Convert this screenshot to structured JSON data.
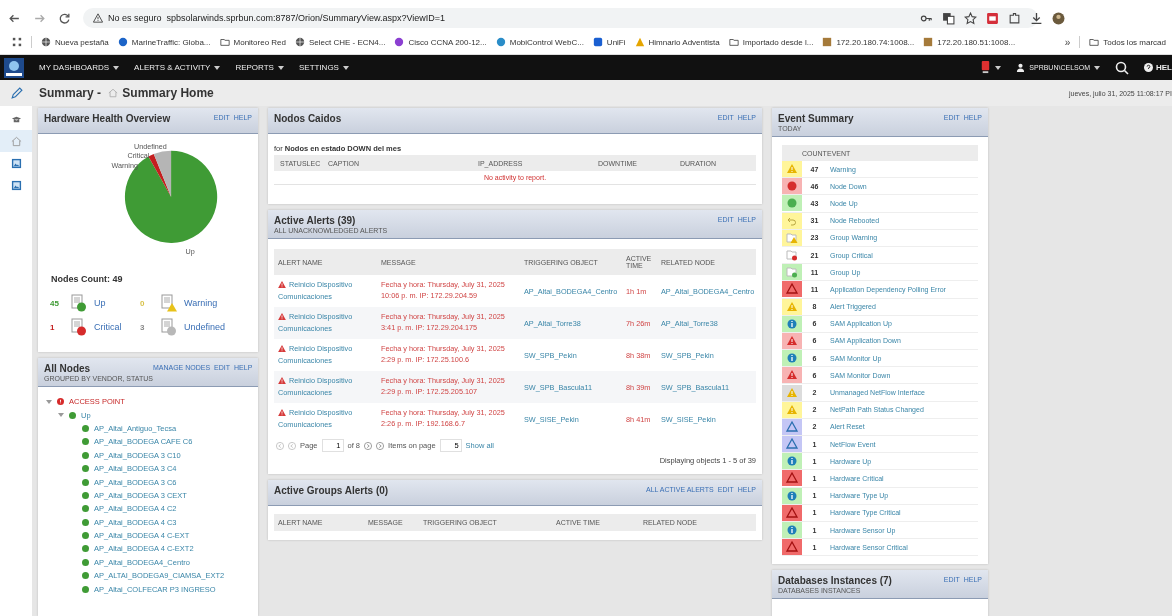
{
  "browser": {
    "security": "No es seguro",
    "url": "spbsolarwinds.sprbun.com:8787/Orion/SummaryView.aspx?ViewID=1",
    "bookmarks": [
      "Nueva pestaña",
      "MarineTraffic: Globa...",
      "Monitoreo Red",
      "Select CHE - ECN4...",
      "Cisco CCNA 200-12...",
      "MobiControl WebC...",
      "UniFi",
      "Himnario Adventista",
      "Importado desde l...",
      "172.20.180.74:1008...",
      "172.20.180.51:1008..."
    ],
    "more": "»",
    "all_bookmarks": "Todos los marcad"
  },
  "nav": {
    "menus": [
      "MY DASHBOARDS",
      "ALERTS & ACTIVITY",
      "REPORTS",
      "SETTINGS"
    ],
    "user": "SPRBUN\\CELSOM",
    "help": "HEL"
  },
  "title": {
    "prefix": "Summary - ",
    "view": "Summary Home",
    "datetime": "jueves, julio 31, 2025 11:08:17 PI"
  },
  "rail": [
    {
      "kind": "hat",
      "selected": false
    },
    {
      "kind": "home",
      "selected": true
    },
    {
      "kind": "image",
      "selected": false
    },
    {
      "kind": "image",
      "selected": false
    }
  ],
  "hardware": {
    "title": "Hardware Health Overview",
    "links": [
      "EDIT",
      "HELP"
    ],
    "chart_data": {
      "type": "pie",
      "categories": [
        "Up",
        "Warning",
        "Critical",
        "Undefined"
      ],
      "values": [
        91.84,
        0,
        2.04,
        6.12
      ]
    },
    "count_label": "Nodes Count: 49",
    "legend": [
      {
        "count": "45",
        "label": "Up",
        "kind": "up"
      },
      {
        "count": "0",
        "label": "Warning",
        "kind": "warning"
      },
      {
        "count": "1",
        "label": "Critical",
        "kind": "critical"
      },
      {
        "count": "3",
        "label": "Undefined",
        "kind": "undefined"
      }
    ]
  },
  "all_nodes": {
    "title": "All Nodes",
    "subtitle": "GROUPED BY VENDOR, STATUS",
    "links": [
      "MANAGE NODES",
      "EDIT",
      "HELP"
    ],
    "tree": [
      {
        "label": "ACCESS POINT",
        "kind": "critical",
        "expanded": true,
        "children": [
          {
            "label": "Up",
            "kind": "up",
            "expanded": true,
            "children": [
              {
                "label": "AP_Altai_Antiguo_Tecsa",
                "kind": "up"
              },
              {
                "label": "AP_Altai_BODEGA CAFE C6",
                "kind": "up"
              },
              {
                "label": "AP_Altai_BODEGA 3 C10",
                "kind": "up"
              },
              {
                "label": "AP_Altai_BODEGA 3 C4",
                "kind": "up"
              },
              {
                "label": "AP_Altai_BODEGA 3 C6",
                "kind": "up"
              },
              {
                "label": "AP_Altai_BODEGA 3 CEXT",
                "kind": "up"
              },
              {
                "label": "AP_Altai_BODEGA 4 C2",
                "kind": "up"
              },
              {
                "label": "AP_Altai_BODEGA 4 C3",
                "kind": "up"
              },
              {
                "label": "AP_Altai_BODEGA 4 C-EXT",
                "kind": "up"
              },
              {
                "label": "AP_Altai_BODEGA 4 C-EXT2",
                "kind": "up"
              },
              {
                "label": "AP_Altai_BODEGA4_Centro",
                "kind": "up"
              },
              {
                "label": "AP_ALTAI_BODEGA9_CIAMSA_EXT2",
                "kind": "up"
              },
              {
                "label": "AP_Altai_COLFECAR P3 INGRESO",
                "kind": "up"
              }
            ]
          }
        ]
      }
    ]
  },
  "nodos_caidos": {
    "title": "Nodos Caidos",
    "links": [
      "EDIT",
      "HELP"
    ],
    "intro": "for **Nodos en estado DOWN del mes**",
    "columns": [
      "STATUSLEC",
      "CAPTION",
      "IP_ADDRESS",
      "DOWNTIME",
      "DURATION"
    ],
    "empty": "No activity to report."
  },
  "active_alerts": {
    "title": "Active Alerts (39)",
    "subtitle": "ALL UNACKNOWLEDGED ALERTS",
    "links": [
      "EDIT",
      "HELP"
    ],
    "columns": [
      "ALERT NAME",
      "MESSAGE",
      "TRIGGERING OBJECT",
      "ACTIVE TIME",
      "RELATED NODE"
    ],
    "rows": [
      {
        "name": "Reinicio Dispositivo Comunicaciones",
        "message": "Fecha y hora: Thursday, July 31, 2025 10:06 p. m. IP: 172.29.204.59",
        "object": "AP_Altai_BODEGA4_Centro",
        "time": "1h 1m",
        "node": "AP_Altai_BODEGA4_Centro"
      },
      {
        "name": "Reinicio Dispositivo Comunicaciones",
        "message": "Fecha y hora: Thursday, July 31, 2025 3:41 p. m. IP: 172.29.204.175",
        "object": "AP_Altai_Torre38",
        "time": "7h 26m",
        "node": "AP_Altai_Torre38"
      },
      {
        "name": "Reinicio Dispositivo Comunicaciones",
        "message": "Fecha y hora: Thursday, July 31, 2025 2:29 p. m. IP: 172.25.100.6",
        "object": "SW_SPB_Pekin",
        "time": "8h 38m",
        "node": "SW_SPB_Pekin"
      },
      {
        "name": "Reinicio Dispositivo Comunicaciones",
        "message": "Fecha y hora: Thursday, July 31, 2025 2:29 p. m. IP: 172.25.205.107",
        "object": "SW_SPB_Bascula11",
        "time": "8h 39m",
        "node": "SW_SPB_Bascula11"
      },
      {
        "name": "Reinicio Dispositivo Comunicaciones",
        "message": "Fecha y hora: Thursday, July 31, 2025 2:26 p. m. IP: 192.168.6.7",
        "object": "SW_SISE_Pekin",
        "time": "8h 41m",
        "node": "SW_SISE_Pekin"
      }
    ],
    "pager": {
      "page_label": "Page",
      "page": "1",
      "of": "of 8",
      "items_label": "Items on page",
      "items": "5",
      "show_all": "Show all"
    },
    "displaying": "Displaying objects 1 - 5 of 39"
  },
  "group_alerts": {
    "title": "Active Groups Alerts (0)",
    "links": [
      "ALL ACTIVE ALERTS",
      "EDIT",
      "HELP"
    ],
    "columns": [
      "ALERT NAME",
      "MESSAGE",
      "TRIGGERING OBJECT",
      "ACTIVE TIME",
      "RELATED NODE"
    ]
  },
  "events": {
    "title": "Event Summary",
    "subtitle": "TODAY",
    "links": [
      "EDIT",
      "HELP"
    ],
    "columns": [
      "COUNT",
      "EVENT"
    ],
    "rows": [
      {
        "count": "47",
        "event": "Warning",
        "kind": "warning"
      },
      {
        "count": "46",
        "event": "Node Down",
        "kind": "down"
      },
      {
        "count": "43",
        "event": "Node Up",
        "kind": "up"
      },
      {
        "count": "31",
        "event": "Node Rebooted",
        "kind": "reboot"
      },
      {
        "count": "23",
        "event": "Group Warning",
        "kind": "group-warning"
      },
      {
        "count": "21",
        "event": "Group Critical",
        "kind": "group-critical"
      },
      {
        "count": "11",
        "event": "Group Up",
        "kind": "group-up"
      },
      {
        "count": "11",
        "event": "Application Dependency Polling Error",
        "kind": "critical"
      },
      {
        "count": "8",
        "event": "Alert Triggered",
        "kind": "warning"
      },
      {
        "count": "6",
        "event": "SAM Application Up",
        "kind": "info"
      },
      {
        "count": "6",
        "event": "SAM Application Down",
        "kind": "alert-down"
      },
      {
        "count": "6",
        "event": "SAM Monitor Up",
        "kind": "info"
      },
      {
        "count": "6",
        "event": "SAM Monitor Down",
        "kind": "alert-down"
      },
      {
        "count": "2",
        "event": "Unmanaged NetFlow Interface",
        "kind": "unmanaged"
      },
      {
        "count": "2",
        "event": "NetPath Path Status Changed",
        "kind": "warning"
      },
      {
        "count": "2",
        "event": "Alert Reset",
        "kind": "reset"
      },
      {
        "count": "1",
        "event": "NetFlow Event",
        "kind": "reset"
      },
      {
        "count": "1",
        "event": "Hardware Up",
        "kind": "info"
      },
      {
        "count": "1",
        "event": "Hardware Critical",
        "kind": "critical"
      },
      {
        "count": "1",
        "event": "Hardware Type Up",
        "kind": "info"
      },
      {
        "count": "1",
        "event": "Hardware Type Critical",
        "kind": "critical"
      },
      {
        "count": "1",
        "event": "Hardware Sensor Up",
        "kind": "info"
      },
      {
        "count": "1",
        "event": "Hardware Sensor Critical",
        "kind": "critical"
      }
    ]
  },
  "databases": {
    "title": "Databases Instances (7)",
    "subtitle": "DATABASES INSTANCES",
    "links": [
      "EDIT",
      "HELP"
    ]
  }
}
